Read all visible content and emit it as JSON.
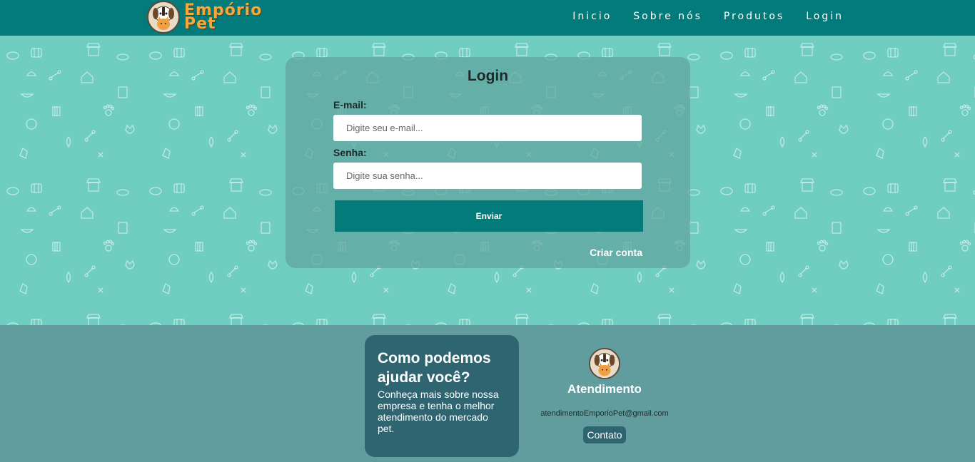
{
  "header": {
    "logo_line1": "Empório",
    "logo_line2": "Pet",
    "nav": [
      "Inicio",
      "Sobre nós",
      "Produtos",
      "Login"
    ]
  },
  "login": {
    "title": "Login",
    "email_label": "E-mail:",
    "email_placeholder": "Digite seu e-mail...",
    "password_label": "Senha:",
    "password_placeholder": "Digite sua senha...",
    "submit_label": "Enviar",
    "create_account_label": "Criar conta"
  },
  "footer": {
    "help_title": "Como podemos ajudar você?",
    "help_text": "Conheça mais sobre nossa empresa e tenha o melhor atendimento do mercado pet.",
    "attendance_title": "Atendimento",
    "email": "atendimentoEmporioPet@gmail.com",
    "contact_label": "Contato"
  },
  "colors": {
    "header_bg": "#037b7b",
    "pattern_bg": "#6fcdc2",
    "footer_bg": "#619c9e",
    "help_box_bg": "#2f6471",
    "logo_text": "#f5a93a"
  },
  "icons": [
    "dog-cat-logo-icon",
    "pet-pattern-icons"
  ]
}
